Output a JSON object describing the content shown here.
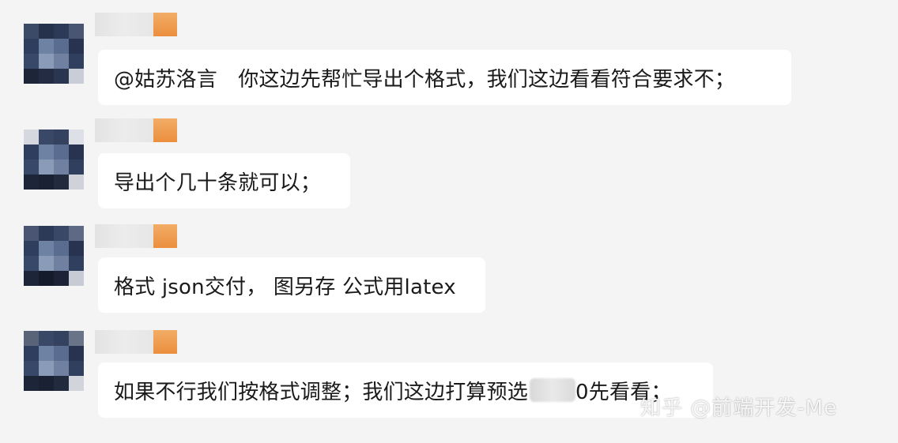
{
  "messages": [
    {
      "pre": "@姑苏洛言　你这边先帮忙导出个格式，我们这边看看符合要求不；"
    },
    {
      "pre": "导出个几十条就可以；"
    },
    {
      "pre": "格式 json交付，  图另存 公式用latex"
    },
    {
      "pre": "如果不行我们按格式调整；我们这边打算预选",
      "post": "0先看看；"
    }
  ],
  "watermark": "知乎 @前端开发-Me",
  "colors": {
    "background": "#f4f4f4",
    "bubble": "#ffffff",
    "name_accent": "#eb8f3e"
  },
  "icons": [
    "avatar-blurred",
    "name-blurred"
  ]
}
